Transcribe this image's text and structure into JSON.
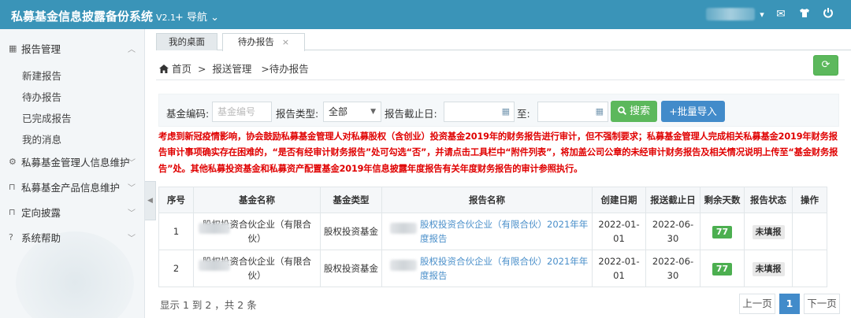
{
  "header": {
    "title": "私募基金信息披露备份系统",
    "version": "V2.1",
    "nav_label": "+ 导航 ⌄",
    "icons": [
      "chevron-down-icon",
      "mail-icon",
      "shirt-icon",
      "power-icon"
    ]
  },
  "sidebar": {
    "groups": [
      {
        "label": "报告管理",
        "icon": "document-icon",
        "chevron": "︿",
        "children": [
          "新建报告",
          "待办报告",
          "已完成报告",
          "我的消息"
        ]
      },
      {
        "label": "私募基金管理人信息维护",
        "icon": "gear-icon",
        "chevron": "﹀"
      },
      {
        "label": "私募基金产品信息维护",
        "icon": "folder-icon",
        "chevron": "﹀"
      },
      {
        "label": "定向披露",
        "icon": "folder-icon",
        "chevron": "﹀"
      },
      {
        "label": "系统帮助",
        "icon": "help-icon",
        "chevron": "﹀"
      }
    ]
  },
  "tabs": [
    {
      "label": "我的桌面",
      "active": false
    },
    {
      "label": "待办报告",
      "active": true,
      "close": "×"
    }
  ],
  "breadcrumb": {
    "home": "首页",
    "sep": ">",
    "level1": "报送管理",
    "level2": ">待办报告"
  },
  "search": {
    "fund_code_label": "基金编码:",
    "fund_code_placeholder": "基金编号",
    "report_type_label": "报告类型:",
    "report_type_value": "全部",
    "deadline_label": "报告截止日:",
    "to_label": "至:",
    "search_button": "搜索",
    "import_button": "+批量导入"
  },
  "notice": "考虑到新冠疫情影响，协会鼓励私募基金管理人对私募股权（含创业）投资基金2019年的财务报告进行审计，但不强制要求；私募基金管理人完成相关私募基金2019年财务报告审计事项确实存在困难的，“是否有经审计财务报告”处可勾选“否”，并请点击工具栏中“附件列表”，将加盖公司公章的未经审计财务报告及相关情况说明上传至“基金财务报告”处。其他私募投资基金和私募资产配置基金2019年信息披露年度报告有关年度财务报告的审计参照执行。",
  "table": {
    "headers": [
      "序号",
      "基金名称",
      "基金类型",
      "报告名称",
      "创建日期",
      "报送截止日",
      "剩余天数",
      "报告状态",
      "操作"
    ],
    "rows": [
      {
        "no": "1",
        "fund_name": "股权投资合伙企业（有限合伙）",
        "fund_type": "股权投资基金",
        "report_name": "股权投资合伙企业（有限合伙）2021年年度报告",
        "created": "2022-01-01",
        "deadline": "2022-06-30",
        "days_left": "77",
        "status": "未填报",
        "action": ""
      },
      {
        "no": "2",
        "fund_name": "股权投资合伙企业（有限合伙）",
        "fund_type": "股权投资基金",
        "report_name": "股权投资合伙企业（有限合伙）2021年年度报告",
        "created": "2022-01-01",
        "deadline": "2022-06-30",
        "days_left": "77",
        "status": "未填报",
        "action": ""
      }
    ]
  },
  "footer": {
    "summary": "显示 1 到 2 ，共 2 条",
    "prev": "上一页",
    "current_page": "1",
    "next": "下一页"
  },
  "colors": {
    "header_bg": "#3a94b8",
    "success": "#5cb85c",
    "primary": "#428bca",
    "notice": "#e00000",
    "link": "#4a8fca"
  }
}
